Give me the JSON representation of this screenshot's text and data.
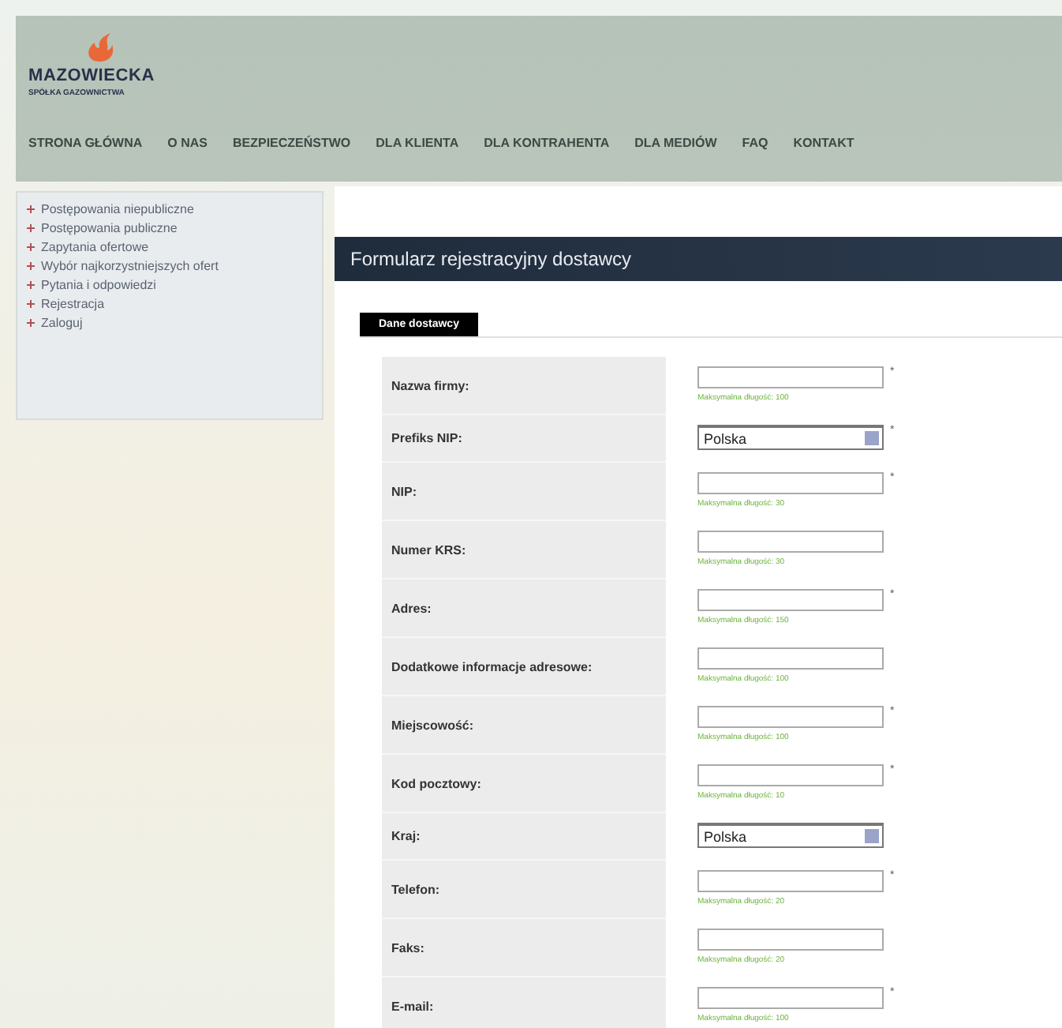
{
  "logo": {
    "name": "MAZOWIECKA",
    "subtitle": "SPÓŁKA GAZOWNICTWA"
  },
  "nav": [
    "STRONA GŁÓWNA",
    "O NAS",
    "BEZPIECZEŃSTWO",
    "DLA KLIENTA",
    "DLA KONTRAHENTA",
    "DLA MEDIÓW",
    "FAQ",
    "KONTAKT"
  ],
  "sidebar": {
    "items": [
      "Postępowania niepubliczne",
      "Postępowania publiczne",
      "Zapytania ofertowe",
      "Wybór najkorzystniejszych ofert",
      "Pytania i odpowiedzi",
      "Rejestracja",
      "Zaloguj"
    ]
  },
  "form": {
    "title": "Formularz rejestracyjny dostawcy",
    "tab": "Dane dostawcy",
    "required_mark": "*",
    "fields": [
      {
        "kind": "text",
        "label": "Nazwa firmy:",
        "required": true,
        "hint": "Maksymalna długość: 100"
      },
      {
        "kind": "select",
        "label": "Prefiks NIP:",
        "required": true,
        "value": "Polska"
      },
      {
        "kind": "text",
        "label": "NIP:",
        "required": true,
        "hint": "Maksymalna długość: 30"
      },
      {
        "kind": "text",
        "label": "Numer KRS:",
        "required": false,
        "hint": "Maksymalna długość: 30"
      },
      {
        "kind": "text",
        "label": "Adres:",
        "required": true,
        "hint": "Maksymalna długość: 150"
      },
      {
        "kind": "text",
        "label": "Dodatkowe informacje adresowe:",
        "required": false,
        "hint": "Maksymalna długość: 100"
      },
      {
        "kind": "text",
        "label": "Miejscowość:",
        "required": true,
        "hint": "Maksymalna długość: 100"
      },
      {
        "kind": "text",
        "label": "Kod pocztowy:",
        "required": true,
        "hint": "Maksymalna długość: 10"
      },
      {
        "kind": "select",
        "label": "Kraj:",
        "required": false,
        "value": "Polska"
      },
      {
        "kind": "text",
        "label": "Telefon:",
        "required": true,
        "hint": "Maksymalna długość: 20"
      },
      {
        "kind": "text",
        "label": "Faks:",
        "required": false,
        "hint": "Maksymalna długość: 20"
      },
      {
        "kind": "text",
        "label": "E-mail:",
        "required": true,
        "hint": "Maksymalna długość: 100"
      }
    ]
  }
}
